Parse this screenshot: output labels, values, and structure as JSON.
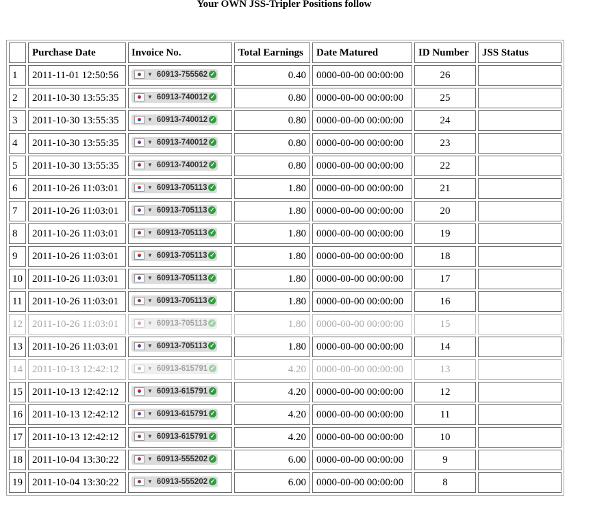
{
  "title": "Your OWN JSS-Tripler Positions follow",
  "headers": [
    "",
    "Purchase Date",
    "Invoice No.",
    "Total Earnings",
    "Date Matured",
    "ID Number",
    "JSS Status"
  ],
  "icons": {
    "flag": "korea-flag-icon",
    "dropdown": "chevron-down-icon",
    "verified": "green-check-icon"
  },
  "rows": [
    {
      "n": "1",
      "date": "2011-11-01 12:50:56",
      "invoice": "60913-755562",
      "earn": "0.40",
      "matured": "0000-00-00 00:00:00",
      "id": "26",
      "status": "",
      "faded": false
    },
    {
      "n": "2",
      "date": "2011-10-30 13:55:35",
      "invoice": "60913-740012",
      "earn": "0.80",
      "matured": "0000-00-00 00:00:00",
      "id": "25",
      "status": "",
      "faded": false
    },
    {
      "n": "3",
      "date": "2011-10-30 13:55:35",
      "invoice": "60913-740012",
      "earn": "0.80",
      "matured": "0000-00-00 00:00:00",
      "id": "24",
      "status": "",
      "faded": false
    },
    {
      "n": "4",
      "date": "2011-10-30 13:55:35",
      "invoice": "60913-740012",
      "earn": "0.80",
      "matured": "0000-00-00 00:00:00",
      "id": "23",
      "status": "",
      "faded": false
    },
    {
      "n": "5",
      "date": "2011-10-30 13:55:35",
      "invoice": "60913-740012",
      "earn": "0.80",
      "matured": "0000-00-00 00:00:00",
      "id": "22",
      "status": "",
      "faded": false
    },
    {
      "n": "6",
      "date": "2011-10-26 11:03:01",
      "invoice": "60913-705113",
      "earn": "1.80",
      "matured": "0000-00-00 00:00:00",
      "id": "21",
      "status": "",
      "faded": false
    },
    {
      "n": "7",
      "date": "2011-10-26 11:03:01",
      "invoice": "60913-705113",
      "earn": "1.80",
      "matured": "0000-00-00 00:00:00",
      "id": "20",
      "status": "",
      "faded": false
    },
    {
      "n": "8",
      "date": "2011-10-26 11:03:01",
      "invoice": "60913-705113",
      "earn": "1.80",
      "matured": "0000-00-00 00:00:00",
      "id": "19",
      "status": "",
      "faded": false
    },
    {
      "n": "9",
      "date": "2011-10-26 11:03:01",
      "invoice": "60913-705113",
      "earn": "1.80",
      "matured": "0000-00-00 00:00:00",
      "id": "18",
      "status": "",
      "faded": false
    },
    {
      "n": "10",
      "date": "2011-10-26 11:03:01",
      "invoice": "60913-705113",
      "earn": "1.80",
      "matured": "0000-00-00 00:00:00",
      "id": "17",
      "status": "",
      "faded": false
    },
    {
      "n": "11",
      "date": "2011-10-26 11:03:01",
      "invoice": "60913-705113",
      "earn": "1.80",
      "matured": "0000-00-00 00:00:00",
      "id": "16",
      "status": "",
      "faded": false
    },
    {
      "n": "12",
      "date": "2011-10-26 11:03:01",
      "invoice": "60913-705113",
      "earn": "1.80",
      "matured": "0000-00-00 00:00:00",
      "id": "15",
      "status": "",
      "faded": true
    },
    {
      "n": "13",
      "date": "2011-10-26 11:03:01",
      "invoice": "60913-705113",
      "earn": "1.80",
      "matured": "0000-00-00 00:00:00",
      "id": "14",
      "status": "",
      "faded": false
    },
    {
      "n": "14",
      "date": "2011-10-13 12:42:12",
      "invoice": "60913-615791",
      "earn": "4.20",
      "matured": "0000-00-00 00:00:00",
      "id": "13",
      "status": "",
      "faded": true
    },
    {
      "n": "15",
      "date": "2011-10-13 12:42:12",
      "invoice": "60913-615791",
      "earn": "4.20",
      "matured": "0000-00-00 00:00:00",
      "id": "12",
      "status": "",
      "faded": false
    },
    {
      "n": "16",
      "date": "2011-10-13 12:42:12",
      "invoice": "60913-615791",
      "earn": "4.20",
      "matured": "0000-00-00 00:00:00",
      "id": "11",
      "status": "",
      "faded": false
    },
    {
      "n": "17",
      "date": "2011-10-13 12:42:12",
      "invoice": "60913-615791",
      "earn": "4.20",
      "matured": "0000-00-00 00:00:00",
      "id": "10",
      "status": "",
      "faded": false
    },
    {
      "n": "18",
      "date": "2011-10-04 13:30:22",
      "invoice": "60913-555202",
      "earn": "6.00",
      "matured": "0000-00-00 00:00:00",
      "id": "9",
      "status": "",
      "faded": false
    },
    {
      "n": "19",
      "date": "2011-10-04 13:30:22",
      "invoice": "60913-555202",
      "earn": "6.00",
      "matured": "0000-00-00 00:00:00",
      "id": "8",
      "status": "",
      "faded": false
    }
  ]
}
